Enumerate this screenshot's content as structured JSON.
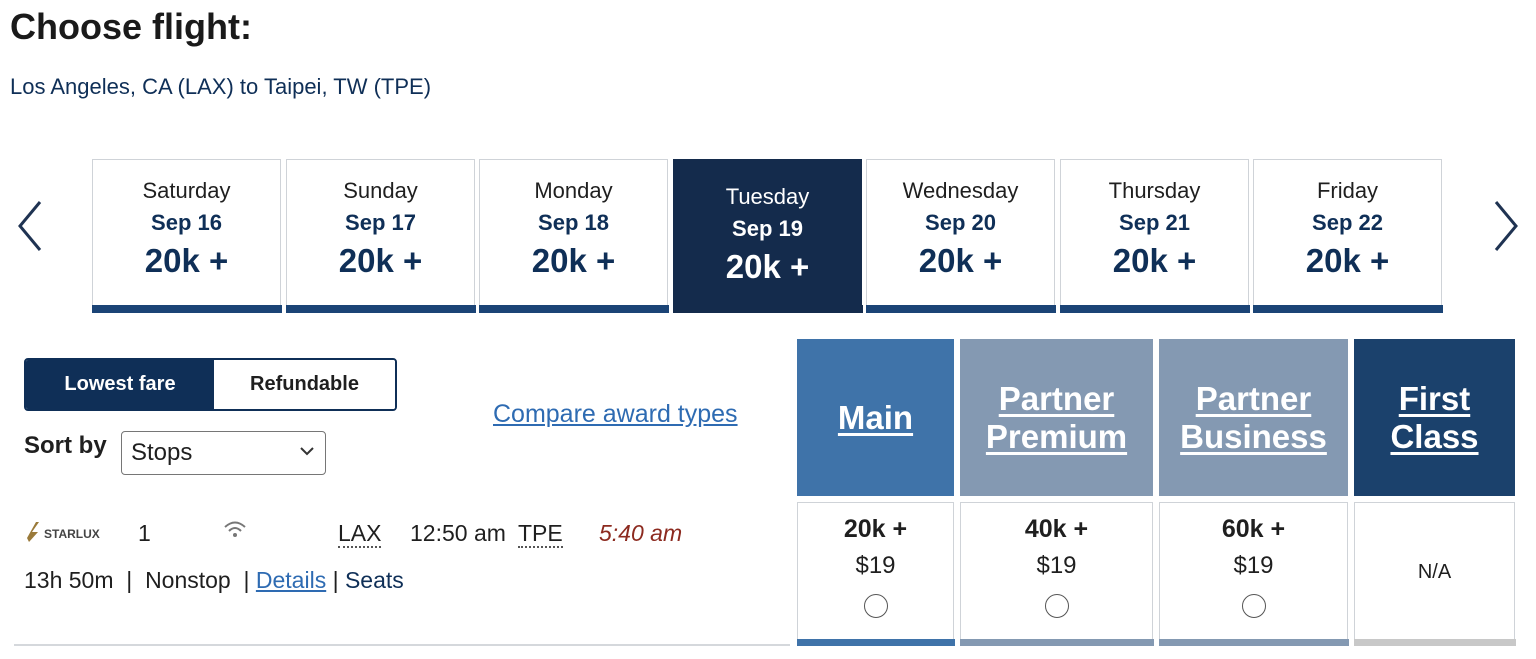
{
  "header": {
    "title": "Choose flight:",
    "route": "Los Angeles, CA (LAX) to Taipei, TW (TPE)"
  },
  "date_nav": {
    "prev_icon": "chevron-left-icon",
    "next_icon": "chevron-right-icon",
    "days": [
      {
        "dow": "Saturday",
        "date": "Sep 16",
        "points": "20k +",
        "selected": false
      },
      {
        "dow": "Sunday",
        "date": "Sep 17",
        "points": "20k +",
        "selected": false
      },
      {
        "dow": "Monday",
        "date": "Sep 18",
        "points": "20k +",
        "selected": false
      },
      {
        "dow": "Tuesday",
        "date": "Sep 19",
        "points": "20k +",
        "selected": true
      },
      {
        "dow": "Wednesday",
        "date": "Sep 20",
        "points": "20k +",
        "selected": false
      },
      {
        "dow": "Thursday",
        "date": "Sep 21",
        "points": "20k +",
        "selected": false
      },
      {
        "dow": "Friday",
        "date": "Sep 22",
        "points": "20k +",
        "selected": false
      }
    ]
  },
  "fare_toggle": {
    "lowest": "Lowest fare",
    "refundable": "Refundable",
    "selected": "Lowest fare"
  },
  "sort": {
    "label": "Sort by",
    "value": "Stops"
  },
  "compare_link": "Compare award types",
  "cabins": [
    {
      "line1": "Main",
      "line2": "",
      "color": "#3f73a9"
    },
    {
      "line1": "Partner",
      "line2": "Premium",
      "color": "#8499b2"
    },
    {
      "line1": "Partner",
      "line2": "Business",
      "color": "#8499b2"
    },
    {
      "line1": "First",
      "line2": "Class",
      "color": "#1b416c"
    }
  ],
  "flight": {
    "airline_logo": "STARLUX",
    "stops": "1",
    "wifi_icon": "wifi-icon",
    "dep_code": "LAX",
    "dep_time": "12:50 am",
    "arr_code": "TPE",
    "arr_time": "5:40 am",
    "duration": "13h 50m",
    "nonstop": "Nonstop",
    "details": "Details",
    "seats": "Seats",
    "fares": [
      {
        "points": "20k +",
        "cash": "$19",
        "available": true,
        "bar_color": "#3f73a9"
      },
      {
        "points": "40k +",
        "cash": "$19",
        "available": true,
        "bar_color": "#8499b2"
      },
      {
        "points": "60k +",
        "cash": "$19",
        "available": true,
        "bar_color": "#8499b2"
      },
      {
        "na": "N/A",
        "available": false,
        "bar_color": "#c8c8c8"
      }
    ]
  }
}
